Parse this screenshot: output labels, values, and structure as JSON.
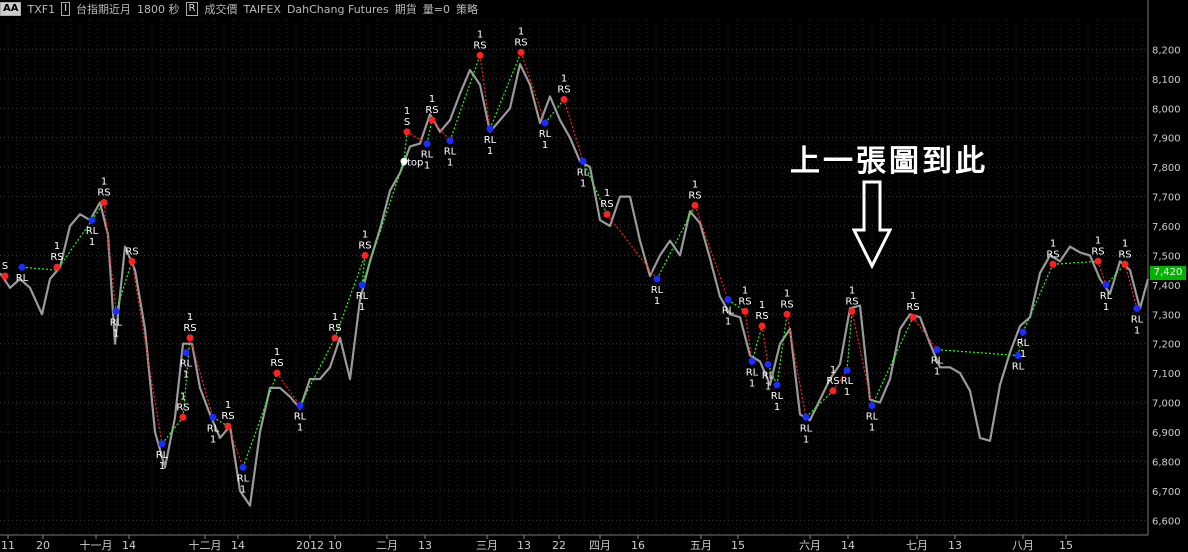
{
  "toolbar": {
    "style_button": "AA",
    "symbol": "TXF1",
    "name": "台指期近月",
    "interval": "1800 秒",
    "price_field": "成交價",
    "exchange": "TAIFEX",
    "broker": "DahChang Futures",
    "asset_type": "期貨",
    "volume": "量=0",
    "strategy": "策略"
  },
  "annotation": "上一張圖到此",
  "last_price": "7,420",
  "colors": {
    "price": "#9a9a9a",
    "rs_dot": "#ff2020",
    "rl_dot": "#1a2cff",
    "long_line": "#20ff20",
    "short_line": "#ff2020",
    "badge": "#00b400"
  },
  "chart_data": {
    "type": "line",
    "ylim": [
      6550,
      8300
    ],
    "yticks": [
      6600,
      6700,
      6800,
      6900,
      7000,
      7100,
      7200,
      7300,
      7400,
      7500,
      7600,
      7700,
      7800,
      7900,
      8000,
      8100,
      8200
    ],
    "ytick_labels": [
      "6,600",
      "6,700",
      "6,800",
      "6,900",
      "7,000",
      "7,100",
      "7,200",
      "7,300",
      "7,400",
      "7,500",
      "7,600",
      "7,700",
      "7,800",
      "7,900",
      "8,000",
      "8,100",
      "8,200"
    ],
    "xlim": [
      0,
      1148
    ],
    "xticks": [
      {
        "x": 8,
        "label": "11"
      },
      {
        "x": 43,
        "label": "20"
      },
      {
        "x": 96,
        "label": "十一月"
      },
      {
        "x": 129,
        "label": "14"
      },
      {
        "x": 205,
        "label": "十二月"
      },
      {
        "x": 238,
        "label": "14"
      },
      {
        "x": 310,
        "label": "2012"
      },
      {
        "x": 335,
        "label": "10"
      },
      {
        "x": 387,
        "label": "二月"
      },
      {
        "x": 425,
        "label": "13"
      },
      {
        "x": 487,
        "label": "三月"
      },
      {
        "x": 524,
        "label": "13"
      },
      {
        "x": 559,
        "label": "22"
      },
      {
        "x": 600,
        "label": "四月"
      },
      {
        "x": 638,
        "label": "16"
      },
      {
        "x": 701,
        "label": "五月"
      },
      {
        "x": 738,
        "label": "15"
      },
      {
        "x": 810,
        "label": "六月"
      },
      {
        "x": 848,
        "label": "14"
      },
      {
        "x": 917,
        "label": "七月"
      },
      {
        "x": 955,
        "label": "13"
      },
      {
        "x": 1023,
        "label": "八月"
      },
      {
        "x": 1066,
        "label": "15"
      }
    ],
    "price_series": [
      [
        0,
        7440
      ],
      [
        10,
        7390
      ],
      [
        20,
        7420
      ],
      [
        30,
        7390
      ],
      [
        42,
        7300
      ],
      [
        50,
        7420
      ],
      [
        60,
        7460
      ],
      [
        70,
        7600
      ],
      [
        80,
        7640
      ],
      [
        90,
        7620
      ],
      [
        100,
        7680
      ],
      [
        108,
        7570
      ],
      [
        115,
        7200
      ],
      [
        125,
        7530
      ],
      [
        135,
        7450
      ],
      [
        145,
        7250
      ],
      [
        155,
        6900
      ],
      [
        165,
        6780
      ],
      [
        175,
        6950
      ],
      [
        183,
        7200
      ],
      [
        192,
        7200
      ],
      [
        200,
        7050
      ],
      [
        210,
        6960
      ],
      [
        220,
        6880
      ],
      [
        230,
        6920
      ],
      [
        240,
        6700
      ],
      [
        250,
        6650
      ],
      [
        260,
        6900
      ],
      [
        270,
        7050
      ],
      [
        280,
        7050
      ],
      [
        290,
        7020
      ],
      [
        300,
        6980
      ],
      [
        310,
        7080
      ],
      [
        320,
        7080
      ],
      [
        330,
        7120
      ],
      [
        340,
        7220
      ],
      [
        350,
        7080
      ],
      [
        360,
        7350
      ],
      [
        370,
        7480
      ],
      [
        380,
        7590
      ],
      [
        390,
        7720
      ],
      [
        400,
        7780
      ],
      [
        410,
        7870
      ],
      [
        420,
        7880
      ],
      [
        430,
        7980
      ],
      [
        440,
        7920
      ],
      [
        450,
        7960
      ],
      [
        460,
        8050
      ],
      [
        470,
        8130
      ],
      [
        480,
        8080
      ],
      [
        490,
        7920
      ],
      [
        500,
        7960
      ],
      [
        510,
        8000
      ],
      [
        520,
        8150
      ],
      [
        530,
        8080
      ],
      [
        540,
        7950
      ],
      [
        550,
        8040
      ],
      [
        560,
        7960
      ],
      [
        570,
        7900
      ],
      [
        580,
        7820
      ],
      [
        590,
        7800
      ],
      [
        600,
        7620
      ],
      [
        610,
        7600
      ],
      [
        620,
        7700
      ],
      [
        630,
        7700
      ],
      [
        640,
        7550
      ],
      [
        650,
        7430
      ],
      [
        660,
        7500
      ],
      [
        670,
        7550
      ],
      [
        680,
        7500
      ],
      [
        690,
        7650
      ],
      [
        700,
        7610
      ],
      [
        710,
        7490
      ],
      [
        720,
        7360
      ],
      [
        730,
        7300
      ],
      [
        740,
        7290
      ],
      [
        750,
        7160
      ],
      [
        760,
        7140
      ],
      [
        770,
        7060
      ],
      [
        780,
        7200
      ],
      [
        790,
        7250
      ],
      [
        800,
        6960
      ],
      [
        810,
        6940
      ],
      [
        820,
        7010
      ],
      [
        830,
        7080
      ],
      [
        840,
        7130
      ],
      [
        850,
        7320
      ],
      [
        860,
        7330
      ],
      [
        870,
        7010
      ],
      [
        880,
        7000
      ],
      [
        890,
        7080
      ],
      [
        900,
        7250
      ],
      [
        910,
        7300
      ],
      [
        920,
        7290
      ],
      [
        930,
        7200
      ],
      [
        940,
        7120
      ],
      [
        950,
        7120
      ],
      [
        960,
        7100
      ],
      [
        970,
        7040
      ],
      [
        980,
        6880
      ],
      [
        990,
        6870
      ],
      [
        1000,
        7060
      ],
      [
        1010,
        7170
      ],
      [
        1020,
        7260
      ],
      [
        1030,
        7290
      ],
      [
        1040,
        7440
      ],
      [
        1050,
        7500
      ],
      [
        1060,
        7480
      ],
      [
        1070,
        7530
      ],
      [
        1080,
        7510
      ],
      [
        1090,
        7500
      ],
      [
        1100,
        7420
      ],
      [
        1110,
        7370
      ],
      [
        1120,
        7480
      ],
      [
        1130,
        7450
      ],
      [
        1140,
        7320
      ],
      [
        1148,
        7420
      ]
    ],
    "strategy_path": [
      {
        "x": 22,
        "y": 7460,
        "trend": "long"
      },
      {
        "x": 57,
        "y": 7450,
        "trend": "long"
      },
      {
        "x": 92,
        "y": 7620,
        "trend": "long"
      },
      {
        "x": 104,
        "y": 7680,
        "trend": "short"
      },
      {
        "x": 116,
        "y": 7310,
        "trend": "long"
      },
      {
        "x": 132,
        "y": 7480,
        "trend": "short"
      },
      {
        "x": 162,
        "y": 6860,
        "trend": "long"
      },
      {
        "x": 183,
        "y": 6950,
        "trend": "long"
      },
      {
        "x": 190,
        "y": 7220,
        "trend": "short"
      },
      {
        "x": 213,
        "y": 6950,
        "trend": "long"
      },
      {
        "x": 228,
        "y": 6920,
        "trend": "short"
      },
      {
        "x": 243,
        "y": 6780,
        "trend": "long"
      },
      {
        "x": 277,
        "y": 7100,
        "trend": "short"
      },
      {
        "x": 300,
        "y": 6990,
        "trend": "long"
      },
      {
        "x": 335,
        "y": 7220,
        "trend": "long"
      },
      {
        "x": 365,
        "y": 7500,
        "trend": "long"
      },
      {
        "x": 362,
        "y": 7400,
        "trend": "long"
      },
      {
        "x": 404,
        "y": 7820,
        "trend": "long"
      },
      {
        "x": 407,
        "y": 7920,
        "trend": "short"
      },
      {
        "x": 427,
        "y": 7880,
        "trend": "long"
      },
      {
        "x": 432,
        "y": 7960,
        "trend": "short"
      },
      {
        "x": 450,
        "y": 7890,
        "trend": "long"
      },
      {
        "x": 480,
        "y": 8180,
        "trend": "short"
      },
      {
        "x": 490,
        "y": 7930,
        "trend": "long"
      },
      {
        "x": 521,
        "y": 8190,
        "trend": "short"
      },
      {
        "x": 545,
        "y": 7950,
        "trend": "long"
      },
      {
        "x": 564,
        "y": 8030,
        "trend": "short"
      },
      {
        "x": 583,
        "y": 7820,
        "trend": "long"
      },
      {
        "x": 607,
        "y": 7640,
        "trend": "short"
      },
      {
        "x": 657,
        "y": 7420,
        "trend": "long"
      },
      {
        "x": 695,
        "y": 7670,
        "trend": "short"
      },
      {
        "x": 728,
        "y": 7350,
        "trend": "long"
      },
      {
        "x": 745,
        "y": 7310,
        "trend": "short"
      },
      {
        "x": 752,
        "y": 7140,
        "trend": "long"
      },
      {
        "x": 762,
        "y": 7260,
        "trend": "short"
      },
      {
        "x": 768,
        "y": 7130,
        "trend": "long"
      },
      {
        "x": 777,
        "y": 7060,
        "trend": "long"
      },
      {
        "x": 787,
        "y": 7300,
        "trend": "short"
      },
      {
        "x": 806,
        "y": 6950,
        "trend": "long"
      },
      {
        "x": 833,
        "y": 7040,
        "trend": "short"
      },
      {
        "x": 847,
        "y": 7110,
        "trend": "long"
      },
      {
        "x": 852,
        "y": 7310,
        "trend": "short"
      },
      {
        "x": 872,
        "y": 6990,
        "trend": "long"
      },
      {
        "x": 913,
        "y": 7290,
        "trend": "short"
      },
      {
        "x": 937,
        "y": 7180,
        "trend": "long"
      },
      {
        "x": 1018,
        "y": 7160,
        "trend": "long"
      },
      {
        "x": 1023,
        "y": 7240,
        "trend": "long"
      },
      {
        "x": 1053,
        "y": 7470,
        "trend": "long"
      },
      {
        "x": 1098,
        "y": 7480,
        "trend": "short"
      },
      {
        "x": 1106,
        "y": 7400,
        "trend": "long"
      },
      {
        "x": 1125,
        "y": 7470,
        "trend": "short"
      },
      {
        "x": 1137,
        "y": 7320,
        "trend": "long"
      }
    ],
    "signals": [
      {
        "x": 5,
        "y": 7430,
        "type": "S",
        "label": "S",
        "qty": ""
      },
      {
        "x": 22,
        "y": 7460,
        "type": "RL",
        "label": "RL",
        "qty": ""
      },
      {
        "x": 57,
        "y": 7460,
        "type": "RS",
        "label": "RS",
        "qty": "1"
      },
      {
        "x": 92,
        "y": 7620,
        "type": "RL",
        "label": "RL",
        "qty": "1"
      },
      {
        "x": 104,
        "y": 7680,
        "type": "RS",
        "label": "RS",
        "qty": "1"
      },
      {
        "x": 116,
        "y": 7310,
        "type": "RL",
        "label": "RL",
        "qty": "1"
      },
      {
        "x": 132,
        "y": 7480,
        "type": "RS",
        "label": "RS",
        "qty": ""
      },
      {
        "x": 162,
        "y": 6860,
        "type": "RL",
        "label": "RL",
        "qty": "1"
      },
      {
        "x": 183,
        "y": 6950,
        "type": "RS",
        "label": "RS",
        "qty": "1"
      },
      {
        "x": 186,
        "y": 7170,
        "type": "RL",
        "label": "RL",
        "qty": "1"
      },
      {
        "x": 190,
        "y": 7220,
        "type": "RS",
        "label": "RS",
        "qty": "1"
      },
      {
        "x": 213,
        "y": 6950,
        "type": "RL",
        "label": "RL",
        "qty": "1"
      },
      {
        "x": 228,
        "y": 6920,
        "type": "RS",
        "label": "RS",
        "qty": "1"
      },
      {
        "x": 243,
        "y": 6780,
        "type": "RL",
        "label": "RL",
        "qty": "1"
      },
      {
        "x": 277,
        "y": 7100,
        "type": "RS",
        "label": "RS",
        "qty": "1"
      },
      {
        "x": 300,
        "y": 6990,
        "type": "RL",
        "label": "RL",
        "qty": "1"
      },
      {
        "x": 335,
        "y": 7220,
        "type": "RS",
        "label": "RS",
        "qty": "1"
      },
      {
        "x": 365,
        "y": 7500,
        "type": "RS",
        "label": "RS",
        "qty": "1"
      },
      {
        "x": 362,
        "y": 7400,
        "type": "RL",
        "label": "RL",
        "qty": "1"
      },
      {
        "x": 404,
        "y": 7820,
        "type": "Stop",
        "label": "Stop",
        "qty": ""
      },
      {
        "x": 407,
        "y": 7920,
        "type": "S",
        "label": "S",
        "qty": "1"
      },
      {
        "x": 427,
        "y": 7880,
        "type": "RL",
        "label": "RL",
        "qty": "1"
      },
      {
        "x": 432,
        "y": 7960,
        "type": "RS",
        "label": "RS",
        "qty": "1"
      },
      {
        "x": 450,
        "y": 7890,
        "type": "RL",
        "label": "RL",
        "qty": "1"
      },
      {
        "x": 480,
        "y": 8180,
        "type": "RS",
        "label": "RS",
        "qty": "1"
      },
      {
        "x": 490,
        "y": 7930,
        "type": "RL",
        "label": "RL",
        "qty": "1"
      },
      {
        "x": 521,
        "y": 8190,
        "type": "RS",
        "label": "RS",
        "qty": "1"
      },
      {
        "x": 545,
        "y": 7950,
        "type": "RL",
        "label": "RL",
        "qty": "1"
      },
      {
        "x": 564,
        "y": 8030,
        "type": "RS",
        "label": "RS",
        "qty": "1"
      },
      {
        "x": 583,
        "y": 7820,
        "type": "RL",
        "label": "RL",
        "qty": "1"
      },
      {
        "x": 607,
        "y": 7640,
        "type": "RS",
        "label": "RS",
        "qty": "1"
      },
      {
        "x": 657,
        "y": 7420,
        "type": "RL",
        "label": "RL",
        "qty": "1"
      },
      {
        "x": 695,
        "y": 7670,
        "type": "RS",
        "label": "RS",
        "qty": "1"
      },
      {
        "x": 728,
        "y": 7350,
        "type": "RL",
        "label": "RL",
        "qty": "1"
      },
      {
        "x": 745,
        "y": 7310,
        "type": "RS",
        "label": "RS",
        "qty": "1"
      },
      {
        "x": 752,
        "y": 7140,
        "type": "RL",
        "label": "RL",
        "qty": "1"
      },
      {
        "x": 762,
        "y": 7260,
        "type": "RS",
        "label": "RS",
        "qty": "1"
      },
      {
        "x": 768,
        "y": 7130,
        "type": "RL",
        "label": "RL",
        "qty": "1"
      },
      {
        "x": 777,
        "y": 7060,
        "type": "RL",
        "label": "RL",
        "qty": "1"
      },
      {
        "x": 787,
        "y": 7300,
        "type": "RS",
        "label": "RS",
        "qty": "1"
      },
      {
        "x": 806,
        "y": 6950,
        "type": "RL",
        "label": "RL",
        "qty": "1"
      },
      {
        "x": 833,
        "y": 7040,
        "type": "RS",
        "label": "RS",
        "qty": "1"
      },
      {
        "x": 847,
        "y": 7110,
        "type": "RL",
        "label": "RL",
        "qty": "1"
      },
      {
        "x": 852,
        "y": 7310,
        "type": "RS",
        "label": "RS",
        "qty": "1"
      },
      {
        "x": 872,
        "y": 6990,
        "type": "RL",
        "label": "RL",
        "qty": "1"
      },
      {
        "x": 913,
        "y": 7290,
        "type": "RS",
        "label": "RS",
        "qty": "1"
      },
      {
        "x": 937,
        "y": 7180,
        "type": "RL",
        "label": "RL",
        "qty": "1"
      },
      {
        "x": 1018,
        "y": 7160,
        "type": "RL",
        "label": "RL",
        "qty": ""
      },
      {
        "x": 1023,
        "y": 7240,
        "type": "RL",
        "label": "RL",
        "qty": "1"
      },
      {
        "x": 1053,
        "y": 7470,
        "type": "RS",
        "label": "RS",
        "qty": "1"
      },
      {
        "x": 1098,
        "y": 7480,
        "type": "RS",
        "label": "RS",
        "qty": "1"
      },
      {
        "x": 1106,
        "y": 7400,
        "type": "RL",
        "label": "RL",
        "qty": "1"
      },
      {
        "x": 1125,
        "y": 7470,
        "type": "RS",
        "label": "RS",
        "qty": "1"
      },
      {
        "x": 1137,
        "y": 7320,
        "type": "RL",
        "label": "RL",
        "qty": "1"
      }
    ],
    "grid": true
  }
}
